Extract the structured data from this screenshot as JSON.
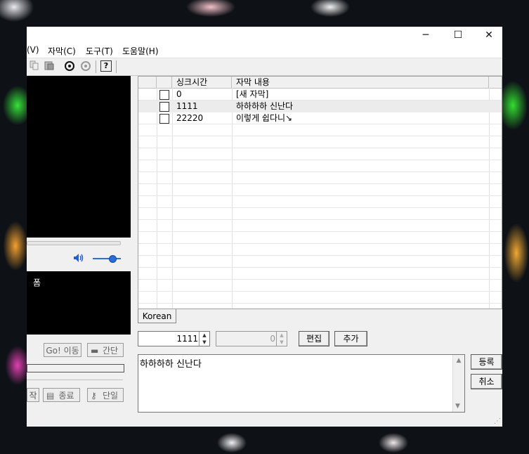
{
  "titlebar": {
    "minimize": "─",
    "maximize": "☐",
    "close": "✕"
  },
  "menu": [
    {
      "label": "(V)"
    },
    {
      "label": "자막(C)"
    },
    {
      "label": "도구(T)"
    },
    {
      "label": "도움말(H)"
    }
  ],
  "toolbar": {
    "help": "?"
  },
  "player": {
    "volume_icon": "🔊",
    "volume_level": 0.7
  },
  "preview": {
    "text": "폼"
  },
  "buttons": {
    "go_move": "Go! 이동",
    "simple": "간단",
    "start": "작",
    "end": "종료",
    "single": "단일"
  },
  "grid": {
    "headers": {
      "sync": "싱크시간",
      "content": "자막 내용"
    },
    "rows": [
      {
        "sync": "0",
        "content": "[새 자막]"
      },
      {
        "sync": "1111",
        "content": "하하하하 신난다"
      },
      {
        "sync": "22220",
        "content": "이렇게 쉽다니↘"
      }
    ]
  },
  "tab": {
    "label": "Korean"
  },
  "editor": {
    "sync_value": "1111",
    "second_value": "0",
    "edit_button": "편집",
    "add_button": "추가",
    "text": "하하하하 신난다",
    "register_button": "등록",
    "cancel_button": "취소"
  }
}
